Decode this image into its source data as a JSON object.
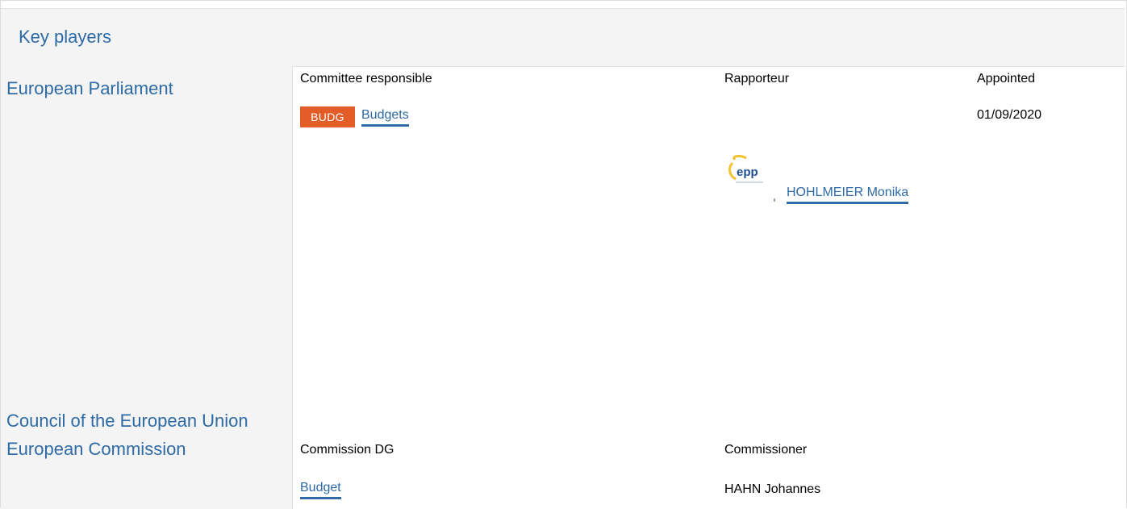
{
  "section": {
    "title": "Key players"
  },
  "parliament": {
    "institution": "European Parliament",
    "committee_header": "Committee responsible",
    "rapporteur_header": "Rapporteur",
    "appointed_header": "Appointed",
    "committee": {
      "code": "BUDG",
      "name": "Budgets",
      "badge_color": "#e35d28"
    },
    "appointed_date": "01/09/2020",
    "rapporteur": {
      "name": "HOHLMEIER Monika",
      "party_logo_icon": "epp-party-logo"
    }
  },
  "council": {
    "institution": "Council of the European Union"
  },
  "commission": {
    "institution": "European Commission",
    "dg_header": "Commission DG",
    "commissioner_header": "Commissioner",
    "dg_name": "Budget",
    "commissioner_name": "HAHN Johannes"
  },
  "colors": {
    "link": "#2d6aa6",
    "panel_bg": "#f4f4f4"
  }
}
